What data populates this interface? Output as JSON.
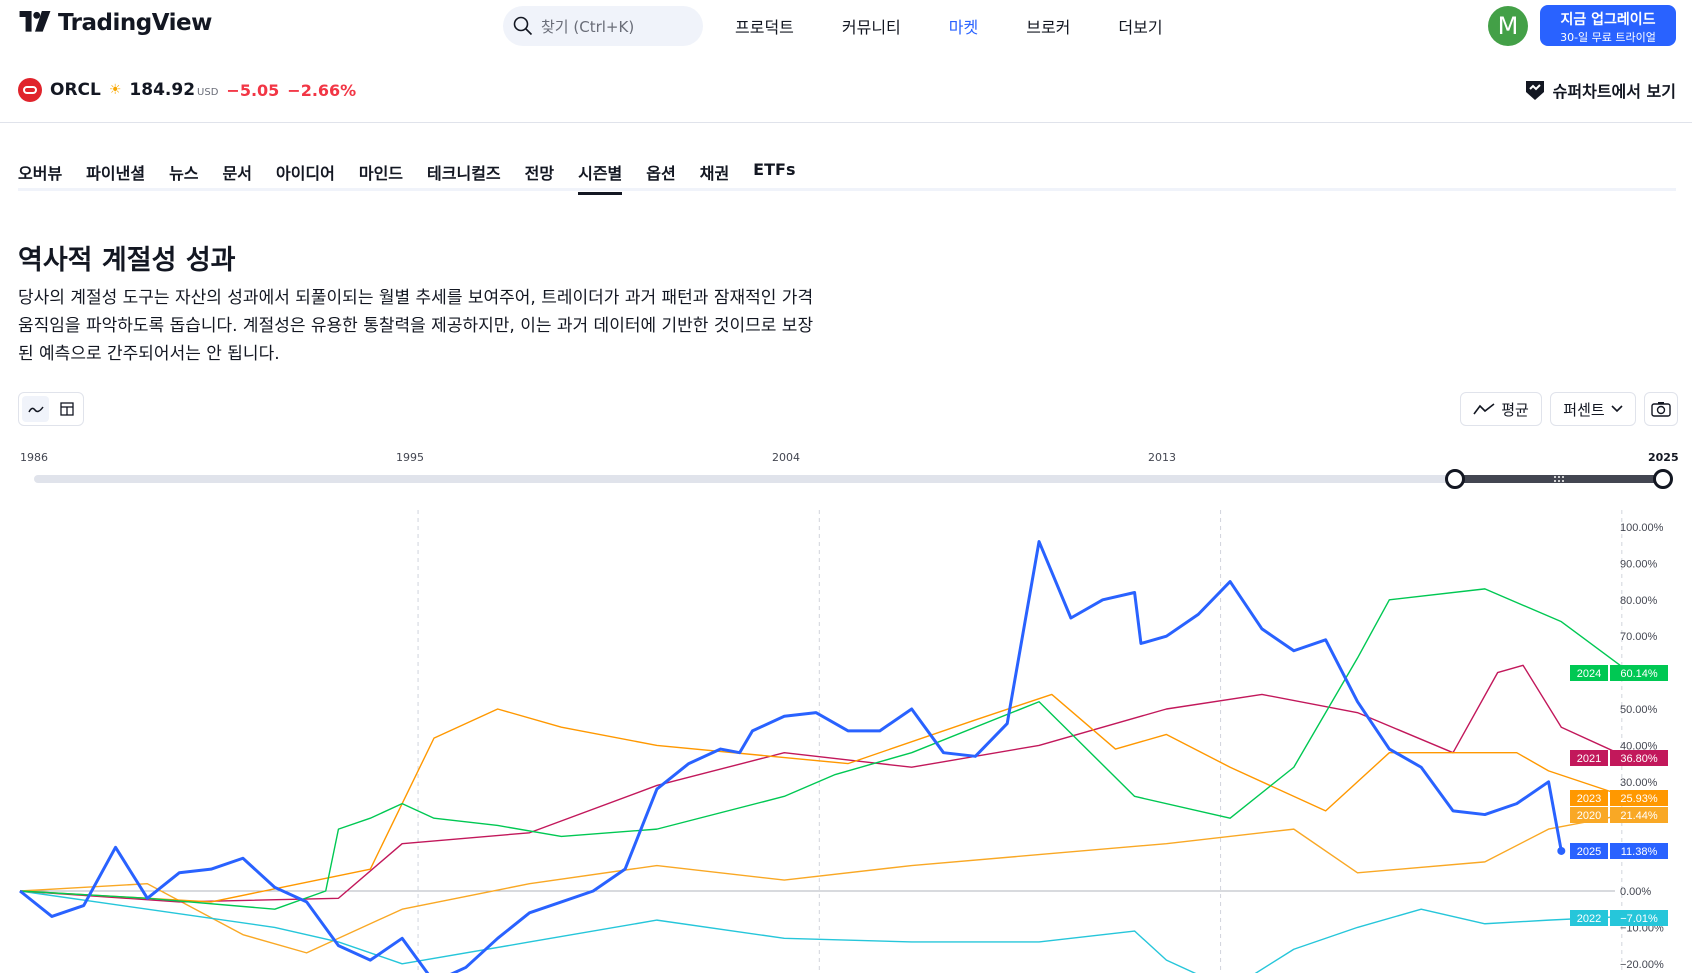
{
  "header": {
    "logo_text": "TradingView",
    "search_placeholder": "찾기 (Ctrl+K)",
    "nav": [
      {
        "label": "프로덕트",
        "active": false
      },
      {
        "label": "커뮤니티",
        "active": false
      },
      {
        "label": "마켓",
        "active": true
      },
      {
        "label": "브로커",
        "active": false
      },
      {
        "label": "더보기",
        "active": false
      }
    ],
    "avatar_letter": "M",
    "upgrade_line1": "지금 업그레이드",
    "upgrade_line2": "30-일 무료 트라이얼"
  },
  "symbol": {
    "ticker": "ORCL",
    "price": "184.92",
    "currency": "USD",
    "change": "−5.05",
    "change_pct": "−2.66%",
    "supercharts_label": "슈퍼차트에서 보기"
  },
  "tabs": [
    {
      "label": "오버뷰",
      "active": false
    },
    {
      "label": "파이낸셜",
      "active": false
    },
    {
      "label": "뉴스",
      "active": false
    },
    {
      "label": "문서",
      "active": false
    },
    {
      "label": "아이디어",
      "active": false
    },
    {
      "label": "마인드",
      "active": false
    },
    {
      "label": "테크니컬즈",
      "active": false
    },
    {
      "label": "전망",
      "active": false
    },
    {
      "label": "시즌별",
      "active": true
    },
    {
      "label": "옵션",
      "active": false
    },
    {
      "label": "채권",
      "active": false
    },
    {
      "label": "ETFs",
      "active": false
    }
  ],
  "section": {
    "title": "역사적 계절성 성과",
    "desc_lines": [
      "당사의 계절성 도구는 자산의 성과에서 되풀이되는 월별 추세를 보여주어, 트레이더가 과거 패턴과 잠재적인 가격",
      "움직임을 파악하도록 돕습니다. 계절성은 유용한 통찰력을 제공하지만, 이는 과거 데이터에 기반한 것이므로 보장",
      "된 예측으로 간주되어서는 안 됩니다."
    ]
  },
  "toolbar": {
    "average_label": "평균",
    "mode_label": "퍼센트"
  },
  "timeline": {
    "ticks": [
      "1986",
      "1995",
      "2004",
      "2013",
      "2025"
    ],
    "selected_range": [
      2020,
      2025
    ]
  },
  "colors": {
    "accent": "#2962ff",
    "negative": "#f23645",
    "y2020": "#f9a825",
    "y2021": "#c2185b",
    "y2022": "#26c6da",
    "y2023": "#ff9800",
    "y2024": "#00c853",
    "y2025": "#2962ff"
  },
  "chart_data": {
    "type": "line",
    "x_unit": "trading day of year",
    "y_axis_ticks": [
      "100.00%",
      "90.00%",
      "80.00%",
      "70.00%",
      "50.00%",
      "40.00%",
      "30.00%",
      "0.00%",
      "−10.00%",
      "−20.00%"
    ],
    "ylim": [
      -22,
      104
    ],
    "xlim": [
      0,
      252
    ],
    "grid": "vertical dashed at quarter boundaries",
    "series": [
      {
        "name": "2024",
        "label_value": "60.14%",
        "color": "#00c853",
        "x": [
          0,
          20,
          40,
          48,
          50,
          55,
          60,
          65,
          75,
          85,
          100,
          120,
          128,
          140,
          160,
          175,
          190,
          200,
          210,
          215,
          230,
          242,
          252
        ],
        "y": [
          0,
          -2,
          -5,
          0,
          17,
          20,
          24,
          20,
          18,
          15,
          17,
          26,
          32,
          38,
          52,
          26,
          20,
          34,
          64,
          80,
          83,
          74,
          61
        ]
      },
      {
        "name": "2021",
        "label_value": "36.80%",
        "color": "#c2185b",
        "x": [
          0,
          25,
          50,
          60,
          80,
          100,
          120,
          140,
          160,
          180,
          195,
          210,
          225,
          232,
          236,
          242,
          252
        ],
        "y": [
          0,
          -3,
          -2,
          13,
          16,
          29,
          38,
          34,
          40,
          50,
          54,
          49,
          38,
          60,
          62,
          45,
          37
        ]
      },
      {
        "name": "2023",
        "label_value": "25.93%",
        "color": "#ff9800",
        "x": [
          0,
          30,
          55,
          65,
          75,
          85,
          100,
          130,
          150,
          162,
          172,
          180,
          190,
          205,
          215,
          235,
          240,
          252
        ],
        "y": [
          0,
          -3,
          6,
          42,
          50,
          45,
          40,
          35,
          47,
          54,
          39,
          43,
          34,
          22,
          38,
          38,
          33,
          26
        ]
      },
      {
        "name": "2020",
        "label_value": "21.44%",
        "color": "#f9a825",
        "x": [
          0,
          20,
          35,
          45,
          60,
          80,
          100,
          120,
          140,
          160,
          180,
          200,
          210,
          230,
          240,
          252
        ],
        "y": [
          0,
          2,
          -12,
          -17,
          -5,
          2,
          7,
          3,
          7,
          10,
          13,
          17,
          5,
          8,
          17,
          21
        ]
      },
      {
        "name": "2025",
        "label_value": "11.38%",
        "color": "#2962ff",
        "x": [
          0,
          5,
          10,
          15,
          20,
          25,
          30,
          35,
          40,
          45,
          50,
          55,
          60,
          65,
          70,
          75,
          80,
          85,
          90,
          95,
          100,
          105,
          110,
          113,
          115,
          120,
          125,
          130,
          135,
          140,
          145,
          150,
          155,
          160,
          165,
          170,
          175,
          176,
          180,
          185,
          190,
          195,
          200,
          205,
          210,
          215,
          220,
          225,
          230,
          235,
          240,
          242
        ],
        "y": [
          0,
          -7,
          -4,
          12,
          -2,
          5,
          6,
          9,
          1,
          -3,
          -15,
          -19,
          -13,
          -25,
          -21,
          -13,
          -6,
          -3,
          0,
          6,
          28,
          35,
          39,
          38,
          44,
          48,
          49,
          44,
          44,
          50,
          38,
          37,
          46,
          96,
          75,
          80,
          82,
          68,
          70,
          76,
          85,
          72,
          66,
          69,
          52,
          39,
          34,
          22,
          21,
          24,
          30,
          11
        ]
      },
      {
        "name": "2022",
        "label_value": "−7.01%",
        "color": "#26c6da",
        "x": [
          0,
          20,
          40,
          50,
          60,
          80,
          100,
          120,
          140,
          160,
          175,
          180,
          190,
          200,
          210,
          220,
          230,
          240,
          252
        ],
        "y": [
          0,
          -5,
          -10,
          -14,
          -20,
          -14,
          -8,
          -13,
          -14,
          -14,
          -11,
          -19,
          -27,
          -16,
          -10,
          -5,
          -9,
          -8,
          -7
        ]
      }
    ]
  }
}
